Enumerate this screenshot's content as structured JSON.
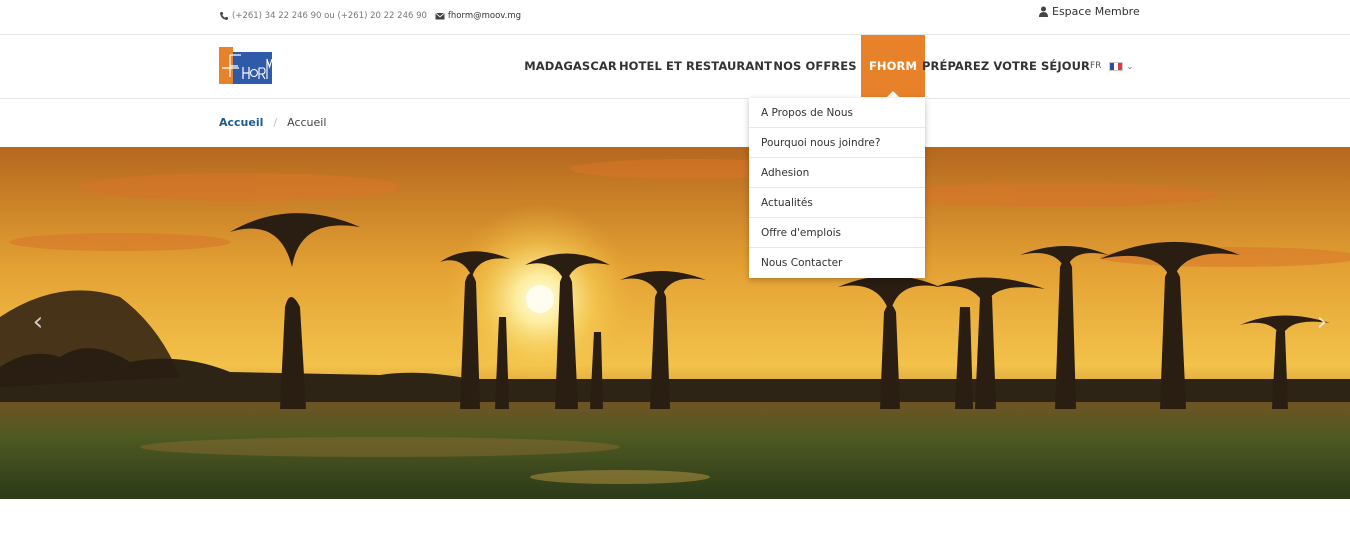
{
  "topbar": {
    "phone": "(+261) 34 22 246 90 ou (+261) 20 22 246 90",
    "email": "fhorm@moov.mg",
    "member_link": "Espace Membre"
  },
  "logo": {
    "text": "FHORM",
    "colors": {
      "orange": "#e8822a",
      "blue": "#2f5aa8"
    }
  },
  "nav": {
    "items": [
      {
        "label": "MADAGASCAR"
      },
      {
        "label": "HOTEL ET RESTAURANT"
      },
      {
        "label": "NOS OFFRES"
      },
      {
        "label": "FHORM",
        "active": true
      },
      {
        "label": "PRÉPAREZ VOTRE SÉJOUR"
      }
    ],
    "language": "FR",
    "accent": "#e8822a"
  },
  "dropdown": {
    "items": [
      "A Propos de Nous",
      "Pourquoi nous joindre?",
      "Adhesion",
      "Actualités",
      "Offre d'emplois",
      "Nous Contacter"
    ]
  },
  "breadcrumb": {
    "home": "Accueil",
    "divider": "/",
    "current": "Accueil"
  },
  "hero": {
    "prev_icon": "chevron-left-icon",
    "next_icon": "chevron-right-icon"
  }
}
